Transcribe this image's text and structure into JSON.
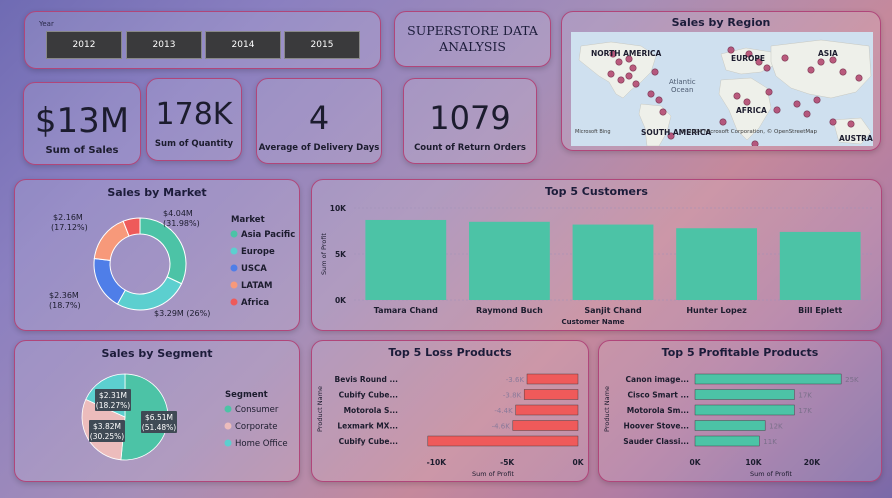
{
  "year_slicer": {
    "label": "Year",
    "years": [
      "2012",
      "2013",
      "2014",
      "2015"
    ]
  },
  "title": {
    "line1": "SUPERSTORE DATA",
    "line2": "ANALYSIS"
  },
  "kpis": {
    "sales": {
      "value": "$13M",
      "label": "Sum of Sales"
    },
    "quantity": {
      "value": "178K",
      "label": "Sum of Quantity"
    },
    "delivery": {
      "value": "4",
      "label": "Average of Delivery Days"
    },
    "returns": {
      "value": "1079",
      "label": "Count of Return Orders"
    }
  },
  "map": {
    "title": "Sales by Region",
    "labels": [
      "NORTH AMERICA",
      "EUROPE",
      "ASIA",
      "Atlantic",
      "Ocean",
      "AFRICA",
      "SOUTH AMERICA",
      "AUSTRAL"
    ],
    "attribution": "© 2024 Microsoft Corporation, © OpenStreetMap",
    "logo": "Microsoft Bing",
    "colors": {
      "water": "#cfe0ef",
      "land": "#eef0ea",
      "bubble": "#b0406a"
    }
  },
  "chart_data": [
    {
      "type": "pie",
      "title": "Sales by Market",
      "legend_title": "Market",
      "donut": true,
      "categories": [
        "Asia Pacific",
        "Europe",
        "USCA",
        "LATAM",
        "Africa"
      ],
      "values": [
        4.04,
        3.29,
        2.36,
        2.16,
        0.75
      ],
      "colors": [
        "#4cc3a6",
        "#5ccfcf",
        "#4f7ee8",
        "#f7997a",
        "#ee5a5a"
      ],
      "data_labels": [
        {
          "value": "$4.04M",
          "pct": "(31.98%)"
        },
        {
          "value": "$3.29M (26%)",
          "pct": ""
        },
        {
          "value": "$2.36M",
          "pct": "(18.7%)"
        },
        {
          "value": "$2.16M",
          "pct": "(17.12%)"
        }
      ],
      "legend_placement": "right"
    },
    {
      "type": "bar",
      "title": "Top 5 Customers",
      "categories": [
        "Tamara Chand",
        "Raymond Buch",
        "Sanjit Chand",
        "Hunter Lopez",
        "Bill Eplett"
      ],
      "values": [
        8700,
        8500,
        8200,
        7800,
        7400
      ],
      "xlabel": "Customer Name",
      "ylabel": "Sum of Profit",
      "yticks": [
        "0K",
        "5K",
        "10K"
      ],
      "ylim": [
        0,
        10000
      ],
      "color": "#4cc3a6",
      "grid": true
    },
    {
      "type": "pie",
      "title": "Sales by Segment",
      "legend_title": "Segment",
      "categories": [
        "Consumer",
        "Corporate",
        "Home Office"
      ],
      "values": [
        6.51,
        3.82,
        2.31
      ],
      "colors": [
        "#4cc3a6",
        "#ecbcbc",
        "#5ccfcf"
      ],
      "data_labels": [
        {
          "value": "$6.51M",
          "pct": "(51.48%)"
        },
        {
          "value": "$3.82M",
          "pct": "(30.25%)"
        },
        {
          "value": "$2.31M",
          "pct": "(18.27%)"
        }
      ],
      "legend_placement": "right"
    },
    {
      "type": "bar",
      "orientation": "horizontal",
      "title": "Top 5 Loss Products",
      "categories": [
        "Bevis Round ...",
        "Cubify Cube...",
        "Motorola S...",
        "Lexmark MX...",
        "Cubify Cube..."
      ],
      "values": [
        -3600,
        -3800,
        -4400,
        -4600,
        -10600
      ],
      "value_labels": [
        "-3.6K",
        "-3.8K",
        "-4.4K",
        "-4.6K",
        ""
      ],
      "xlabel": "Sum of Profit",
      "ylabel": "Product Name",
      "xticks": [
        "-10K",
        "-5K",
        "0K"
      ],
      "xlim": [
        -12000,
        0
      ],
      "color": "#ef5a5a"
    },
    {
      "type": "bar",
      "orientation": "horizontal",
      "title": "Top 5 Profitable Products",
      "categories": [
        "Canon image...",
        "Cisco Smart ...",
        "Motorola Sm...",
        "Hoover Stove...",
        "Sauder Classi..."
      ],
      "values": [
        25000,
        17000,
        17000,
        12000,
        11000
      ],
      "value_labels": [
        "25K",
        "17K",
        "17K",
        "12K",
        "11K"
      ],
      "xlabel": "Sum of Profit",
      "ylabel": "Product Name",
      "xticks": [
        "0K",
        "10K",
        "20K"
      ],
      "xlim": [
        0,
        26000
      ],
      "color": "#4cc3a6"
    }
  ]
}
